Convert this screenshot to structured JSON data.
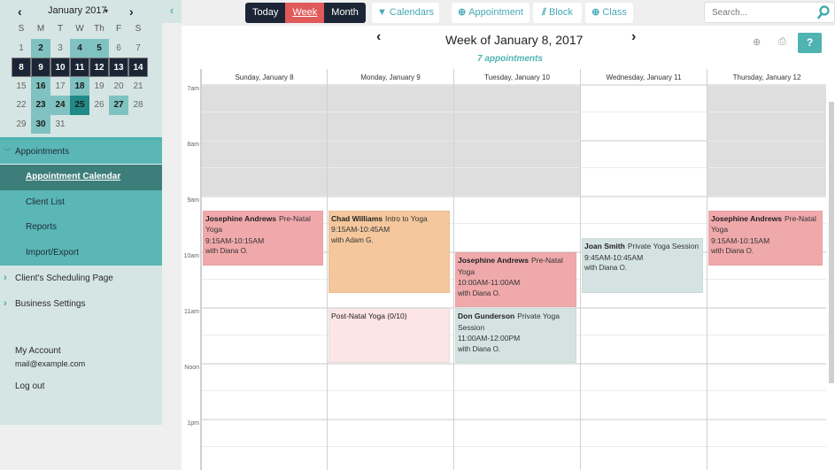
{
  "mini_calendar": {
    "title": "January 2017",
    "prev": "‹",
    "next": "›",
    "caret": "▾",
    "dow": [
      "S",
      "M",
      "T",
      "W",
      "Th",
      "F",
      "S"
    ],
    "weeks": [
      [
        {
          "d": "1",
          "s": ""
        },
        {
          "d": "2",
          "s": "has"
        },
        {
          "d": "3",
          "s": ""
        },
        {
          "d": "4",
          "s": "has"
        },
        {
          "d": "5",
          "s": "has"
        },
        {
          "d": "6",
          "s": ""
        },
        {
          "d": "7",
          "s": ""
        }
      ],
      [
        {
          "d": "8",
          "s": "sel"
        },
        {
          "d": "9",
          "s": "sel"
        },
        {
          "d": "10",
          "s": "sel"
        },
        {
          "d": "11",
          "s": "sel"
        },
        {
          "d": "12",
          "s": "sel"
        },
        {
          "d": "13",
          "s": "sel"
        },
        {
          "d": "14",
          "s": "sel"
        }
      ],
      [
        {
          "d": "15",
          "s": ""
        },
        {
          "d": "16",
          "s": "has"
        },
        {
          "d": "17",
          "s": ""
        },
        {
          "d": "18",
          "s": "has"
        },
        {
          "d": "19",
          "s": ""
        },
        {
          "d": "20",
          "s": ""
        },
        {
          "d": "21",
          "s": ""
        }
      ],
      [
        {
          "d": "22",
          "s": ""
        },
        {
          "d": "23",
          "s": "has"
        },
        {
          "d": "24",
          "s": "has"
        },
        {
          "d": "25",
          "s": "today"
        },
        {
          "d": "26",
          "s": ""
        },
        {
          "d": "27",
          "s": "has"
        },
        {
          "d": "28",
          "s": ""
        }
      ],
      [
        {
          "d": "29",
          "s": ""
        },
        {
          "d": "30",
          "s": "has"
        },
        {
          "d": "31",
          "s": ""
        }
      ]
    ]
  },
  "sidebar": {
    "group_label": "Appointments",
    "items": [
      {
        "label": "Appointment Calendar",
        "active": true
      },
      {
        "label": "Client List",
        "active": false
      },
      {
        "label": "Reports",
        "active": false
      },
      {
        "label": "Import/Export",
        "active": false
      }
    ],
    "links": [
      "Client's Scheduling Page",
      "Business Settings"
    ],
    "account_label": "My Account",
    "account_email": "mail@example.com",
    "logout": "Log out"
  },
  "toolbar": {
    "views": [
      "Today",
      "Week",
      "Month"
    ],
    "active_view": "Week",
    "calendars": "Calendars",
    "appointment": "Appointment",
    "block": "Block",
    "class": "Class",
    "search_placeholder": "Search..."
  },
  "week": {
    "title": "Week of January 8, 2017",
    "count": "7 appointments",
    "help": "?",
    "days": [
      "Sunday, January 8",
      "Monday, January 9",
      "Tuesday, January 10",
      "Wednesday, January 11",
      "Thursday, January 12"
    ],
    "hours": [
      "7am",
      "8am",
      "9am",
      "10am",
      "11am",
      "Noon",
      "1pm"
    ],
    "unavailable": [
      {
        "day": 0,
        "start": 7,
        "end": 9
      },
      {
        "day": 1,
        "start": 7,
        "end": 9
      },
      {
        "day": 2,
        "start": 7,
        "end": 9
      },
      {
        "day": 4,
        "start": 7,
        "end": 9
      }
    ],
    "appointments": [
      {
        "day": 0,
        "start": 9.25,
        "end": 10.25,
        "client": "Josephine Andrews",
        "service": "Pre-Natal Yoga",
        "time": "9:15AM-10:15AM",
        "with": "with Diana O.",
        "color": "#f0a9ab"
      },
      {
        "day": 1,
        "start": 9.25,
        "end": 10.75,
        "client": "Chad Williams",
        "service": "Intro to Yoga",
        "time": "9:15AM-10:45AM",
        "with": "with Adam G.",
        "color": "#f4c79c"
      },
      {
        "day": 1,
        "start": 11,
        "end": 12,
        "client": "",
        "service": "Post-Natal Yoga (0/10)",
        "time": "",
        "with": "",
        "color": "#fde4e5",
        "is_class": true
      },
      {
        "day": 2,
        "start": 10,
        "end": 11,
        "client": "Josephine Andrews",
        "service": "Pre-Natal Yoga",
        "time": "10:00AM-11:00AM",
        "with": "with Diana O.",
        "color": "#f0a9ab"
      },
      {
        "day": 2,
        "start": 11,
        "end": 12,
        "client": "Don Gunderson",
        "service": "Private Yoga Session",
        "time": "11:00AM-12:00PM",
        "with": "with Diana O.",
        "color": "#d4e3e2"
      },
      {
        "day": 3,
        "start": 9.75,
        "end": 10.75,
        "client": "Joan Smith",
        "service": "Private Yoga Session",
        "time": "9:45AM-10:45AM",
        "with": "with Diana O.",
        "color": "#d4e3e2"
      },
      {
        "day": 4,
        "start": 9.25,
        "end": 10.25,
        "client": "Josephine Andrews",
        "service": "Pre-Natal Yoga",
        "time": "9:15AM-10:15AM",
        "with": "with Diana O.",
        "color": "#f0a9ab"
      }
    ]
  }
}
